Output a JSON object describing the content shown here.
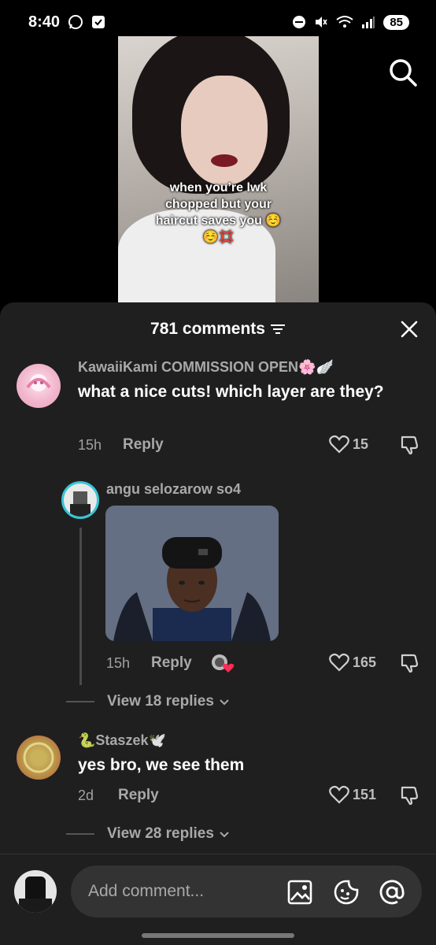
{
  "status_bar": {
    "time": "8:40",
    "battery": "85"
  },
  "video": {
    "caption": "when you’re lwk chopped but your haircut saves you ☺️☺️💢"
  },
  "comments_sheet": {
    "count_label": "781 comments",
    "comments": [
      {
        "username": "KawaiiKami COMMISSION OPEN🌸🪽",
        "text": "what a nice cuts! which layer are they?",
        "time": "15h",
        "reply_label": "Reply",
        "likes": "15"
      },
      {
        "username": "Staszek🕊️",
        "username_prefix": "🐍",
        "text": "yes bro, we see them",
        "time": "2d",
        "reply_label": "Reply",
        "likes": "151",
        "view_replies": "View 28 replies"
      }
    ],
    "reply": {
      "username": "angu selozarow so4",
      "time": "15h",
      "reply_label": "Reply",
      "likes": "165",
      "view_replies": "View 18 replies"
    }
  },
  "composer": {
    "placeholder": "Add comment..."
  }
}
